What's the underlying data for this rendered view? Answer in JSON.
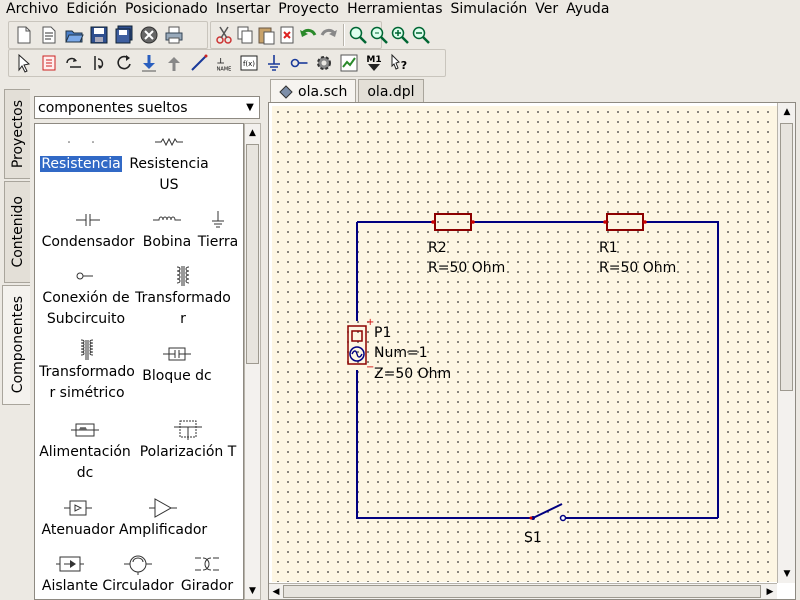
{
  "menubar": {
    "items": [
      "Archivo",
      "Edición",
      "Posicionado",
      "Insertar",
      "Proyecto",
      "Herramientas",
      "Simulación",
      "Ver",
      "Ayuda"
    ]
  },
  "toolbar_icons": {
    "row1": [
      "new-file-icon",
      "new-text-icon",
      "open-folder-icon",
      "save-icon",
      "save-all-icon",
      "close-doc-icon",
      "print-icon",
      "cut-icon",
      "copy-icon",
      "paste-icon",
      "delete-icon",
      "undo-icon",
      "redo-icon",
      "zoom-fit-icon",
      "zoom-selection-icon",
      "zoom-in-icon",
      "zoom-out-icon"
    ],
    "row2": [
      "select-cursor-icon",
      "component-edit-icon",
      "mirror-x-icon",
      "mirror-y-icon",
      "rotate-icon",
      "step-into-icon",
      "step-out-icon",
      "wire-icon",
      "wire-label-icon",
      "equation-icon",
      "ground-icon",
      "port-icon",
      "simulate-gear-icon",
      "view-data-icon",
      "marker-icon",
      "whats-this-icon"
    ]
  },
  "toolbar_glyph_text": {
    "wire_label": "NAME",
    "equation": "f(x)",
    "marker": "M1"
  },
  "side_tabs": [
    "Proyectos",
    "Contenido",
    "Componentes"
  ],
  "component_panel": {
    "category": "componentes sueltos",
    "components": [
      {
        "label": "Resistencia",
        "icon": "resistor-icon",
        "selected": true
      },
      {
        "label": "Resistencia US",
        "icon": "resistor-us-icon",
        "selected": false
      },
      {
        "label": "Condensador",
        "icon": "capacitor-icon",
        "selected": false
      },
      {
        "label": "Bobina",
        "icon": "inductor-icon",
        "selected": false
      },
      {
        "label": "Tierra",
        "icon": "ground-icon",
        "selected": false
      },
      {
        "label": "Conexión de Subcircuito",
        "icon": "subcircuit-port-icon",
        "selected": false
      },
      {
        "label": "Transformador",
        "icon": "transformer-icon",
        "selected": false
      },
      {
        "label": "Transformador simétrico",
        "icon": "symmetric-transformer-icon",
        "selected": false
      },
      {
        "label": "Bloque dc",
        "icon": "dc-block-icon",
        "selected": false
      },
      {
        "label": "Alimentación dc",
        "icon": "dc-feed-icon",
        "selected": false
      },
      {
        "label": "Polarización T",
        "icon": "bias-tee-icon",
        "selected": false
      },
      {
        "label": "Atenuador",
        "icon": "attenuator-icon",
        "selected": false
      },
      {
        "label": "Amplificador",
        "icon": "amplifier-icon",
        "selected": false
      },
      {
        "label": "Aislante",
        "icon": "isolator-icon",
        "selected": false
      },
      {
        "label": "Circulador",
        "icon": "circulator-icon",
        "selected": false
      },
      {
        "label": "Girador",
        "icon": "gyrator-icon",
        "selected": false
      }
    ]
  },
  "doc_tabs": [
    {
      "label": "ola.sch",
      "active": true,
      "icon": "schematic-doc-icon"
    },
    {
      "label": "ola.dpl",
      "active": false
    }
  ],
  "schematic": {
    "R2": {
      "name": "R2",
      "value": "R=50 Ohm"
    },
    "R1": {
      "name": "R1",
      "value": "R=50 Ohm"
    },
    "P1": {
      "name": "P1",
      "num": "Num=1",
      "z": "Z=50 Ohm"
    },
    "S1": {
      "name": "S1"
    },
    "wire_color": "#000080",
    "port_plus": "+",
    "port_minus": "−"
  }
}
